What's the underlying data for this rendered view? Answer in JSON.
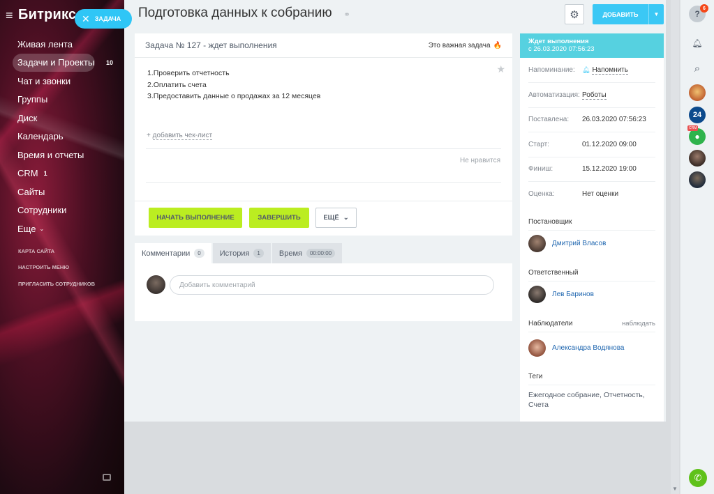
{
  "sidebar": {
    "logo": "Битрикс",
    "task_button": "ЗАДАЧА",
    "items": [
      {
        "label": "Живая лента",
        "count": ""
      },
      {
        "label": "Задачи и Проекты",
        "count": "10"
      },
      {
        "label": "Чат и звонки",
        "count": ""
      },
      {
        "label": "Группы",
        "count": ""
      },
      {
        "label": "Диск",
        "count": ""
      },
      {
        "label": "Календарь",
        "count": ""
      },
      {
        "label": "Время и отчеты",
        "count": ""
      },
      {
        "label": "CRM",
        "count": "1"
      },
      {
        "label": "Сайты",
        "count": ""
      },
      {
        "label": "Сотрудники",
        "count": ""
      },
      {
        "label": "Еще",
        "count": ""
      }
    ],
    "links": [
      "КАРТА САЙТА",
      "НАСТРОИТЬ МЕНЮ",
      "ПРИГЛАСИТЬ СОТРУДНИКОВ"
    ]
  },
  "header": {
    "title": "Подготовка данных к собранию",
    "add_button": "ДОБАВИТЬ"
  },
  "task": {
    "heading": "Задача № 127 - ждет выполнения",
    "important": "Это важная задача",
    "description": [
      "1.Проверить отчетность",
      "2.Оплатить счета",
      "3.Предоставить данные о продажах за 12 месяцев"
    ],
    "checklist_prefix": "+",
    "checklist_link": "добавить чек-лист",
    "dislike": "Не нравится",
    "start_button": "НАЧАТЬ ВЫПОЛНЕНИЕ",
    "finish_button": "ЗАВЕРШИТЬ",
    "more_button": "ЕЩЁ"
  },
  "tabs": [
    {
      "label": "Комментарии",
      "badge": "0"
    },
    {
      "label": "История",
      "badge": "1"
    },
    {
      "label": "Время",
      "badge": "00:00:00"
    }
  ],
  "comments": {
    "placeholder": "Добавить комментарий"
  },
  "info": {
    "status_title": "Ждет выполнения",
    "status_date": "с 26.03.2020 07:56:23",
    "rows": [
      {
        "key": "Напоминание:",
        "value": "Напомнить"
      },
      {
        "key": "Автоматизация:",
        "value": "Роботы"
      },
      {
        "key": "Поставлена:",
        "value": "26.03.2020 07:56:23"
      },
      {
        "key": "Старт:",
        "value": "01.12.2020 09:00"
      },
      {
        "key": "Финиш:",
        "value": "15.12.2020 19:00"
      },
      {
        "key": "Оценка:",
        "value": "Нет оценки"
      }
    ],
    "creator_label": "Постановщик",
    "creator": "Дмитрий Власов",
    "responsible_label": "Ответственный",
    "responsible": "Лев Баринов",
    "observers_label": "Наблюдатели",
    "observe_link": "наблюдать",
    "observer": "Александра Водянова",
    "tags_label": "Теги",
    "tags": "Ежегодное собрание, Отчетность, Счета"
  },
  "rightbar": {
    "help": "?",
    "notif_count": "6",
    "b24": "24",
    "crm_tag": "CRM"
  },
  "colors": {
    "accent": "#2fc6f6",
    "lime": "#bbed21",
    "status": "#56d1e0",
    "link": "#2067b0"
  }
}
